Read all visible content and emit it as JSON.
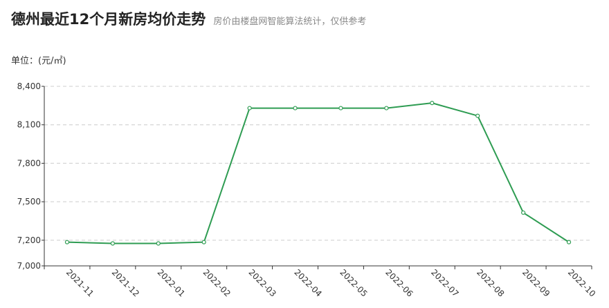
{
  "header": {
    "title": "德州最近12个月新房均价走势",
    "subtitle": "房价由楼盘网智能算法统计，仅供参考"
  },
  "unit_label": "单位：(元/㎡)",
  "colors": {
    "line": "#2e9c52",
    "grid": "#cccccc",
    "axis": "#333333",
    "point_fill": "#ffffff"
  },
  "chart_data": {
    "type": "line",
    "title": "德州最近12个月新房均价走势",
    "subtitle": "房价由楼盘网智能算法统计，仅供参考",
    "ylabel": "单位：(元/㎡)",
    "xlabel": "",
    "categories": [
      "2021-11",
      "2021-12",
      "2022-01",
      "2022-02",
      "2022-03",
      "2022-04",
      "2022-05",
      "2022-06",
      "2022-07",
      "2022-08",
      "2022-09",
      "2022-10"
    ],
    "series": [
      {
        "values": [
          7185,
          7175,
          7175,
          7185,
          8230,
          8230,
          8230,
          8230,
          8270,
          8170,
          7415,
          7185
        ]
      }
    ],
    "ylim": [
      7000,
      8400
    ],
    "yticks": [
      7000,
      7200,
      7500,
      7800,
      8100,
      8400
    ],
    "ytick_labels": [
      "7,000",
      "7,200",
      "7,500",
      "7,800",
      "8,100",
      "8,400"
    ],
    "grid": "horizontal dashed",
    "legend": "none"
  }
}
